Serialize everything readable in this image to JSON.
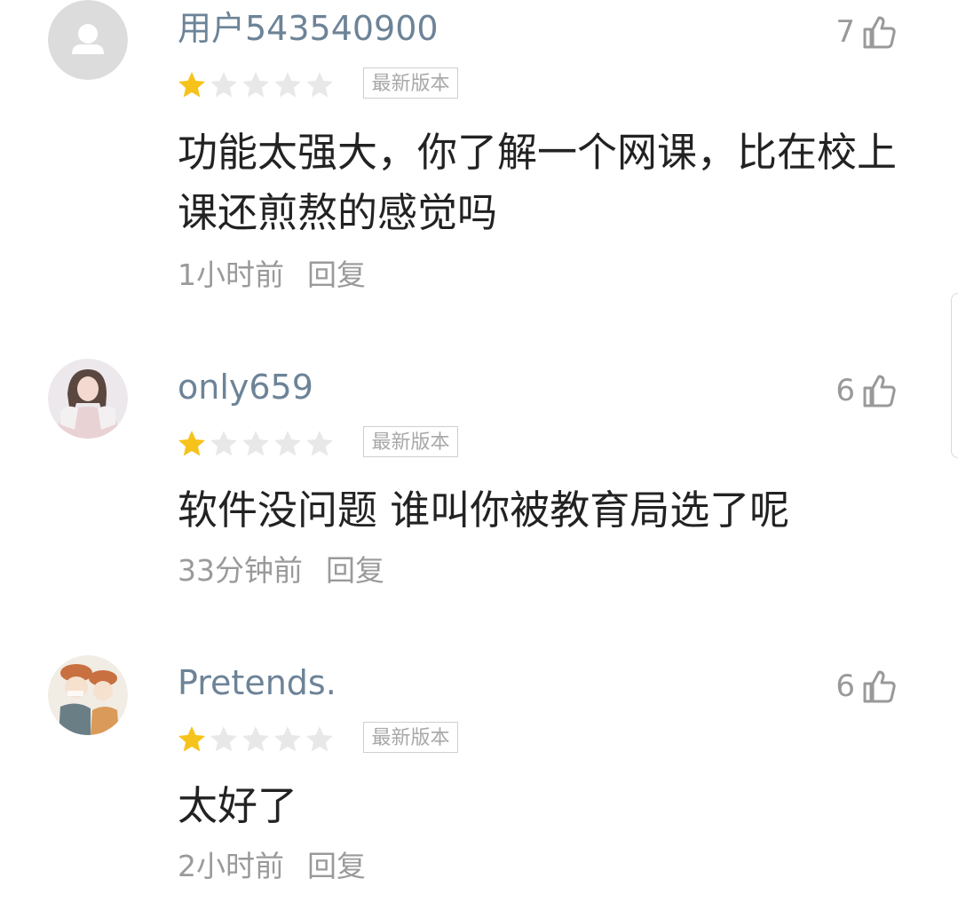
{
  "reviews": [
    {
      "username": "用户543540900",
      "likes": "7",
      "rating": 1,
      "rating_max": 5,
      "badge": "最新版本",
      "content": "功能太强大，你了解一个网课，比在校上课还煎熬的感觉吗",
      "time": "1小时前",
      "reply": "回复",
      "avatar": "default-user-icon"
    },
    {
      "username": "only659",
      "likes": "6",
      "rating": 1,
      "rating_max": 5,
      "badge": "最新版本",
      "content": "软件没问题 谁叫你被教育局选了呢",
      "time": "33分钟前",
      "reply": "回复",
      "avatar": "photo-avatar"
    },
    {
      "username": "Pretends.",
      "likes": "6",
      "rating": 1,
      "rating_max": 5,
      "badge": "最新版本",
      "content": "太好了",
      "time": "2小时前",
      "reply": "回复",
      "avatar": "cartoon-avatar"
    }
  ],
  "colors": {
    "username": "#6d8397",
    "star_filled": "#f6c21c",
    "star_empty": "#e8e8e8",
    "content": "#222222",
    "meta": "#9a9a9a"
  }
}
